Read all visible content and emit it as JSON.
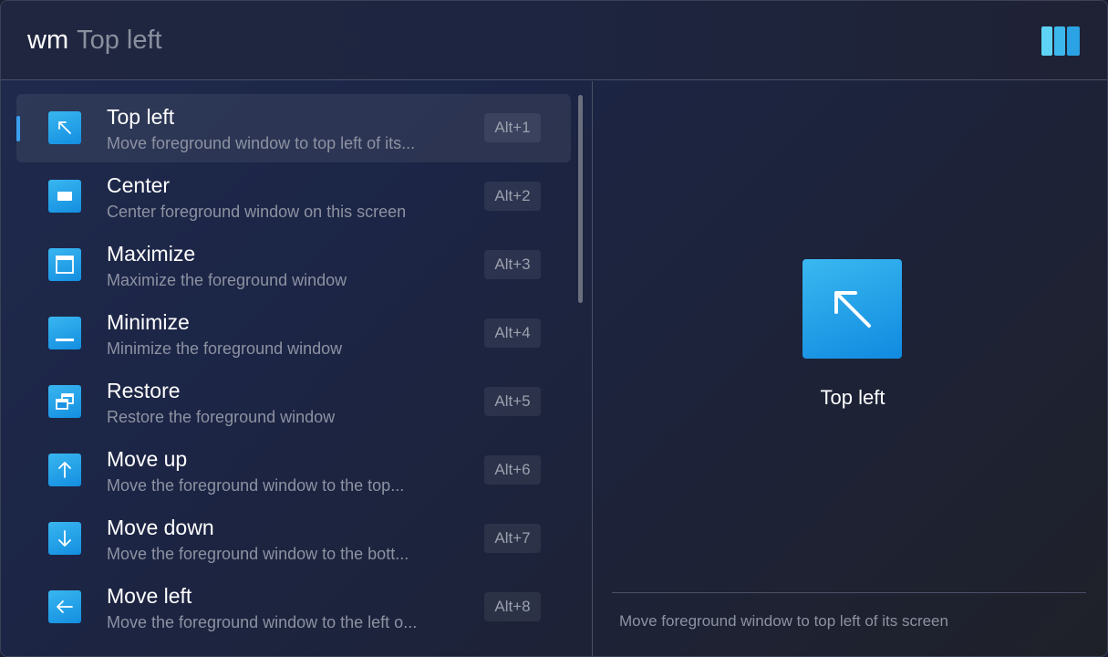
{
  "header": {
    "prefix": "wm",
    "query": "Top left",
    "logo_icon": "wm-app-logo-icon"
  },
  "list": {
    "items": [
      {
        "title": "Top left",
        "description": "Move foreground window to top left of its...",
        "shortcut": "Alt+1",
        "icon": "arrow-up-left-icon",
        "selected": true
      },
      {
        "title": "Center",
        "description": "Center foreground window on this screen",
        "shortcut": "Alt+2",
        "icon": "center-window-icon",
        "selected": false
      },
      {
        "title": "Maximize",
        "description": "Maximize the foreground window",
        "shortcut": "Alt+3",
        "icon": "maximize-icon",
        "selected": false
      },
      {
        "title": "Minimize",
        "description": "Minimize the foreground window",
        "shortcut": "Alt+4",
        "icon": "minimize-icon",
        "selected": false
      },
      {
        "title": "Restore",
        "description": "Restore the foreground window",
        "shortcut": "Alt+5",
        "icon": "restore-icon",
        "selected": false
      },
      {
        "title": "Move up",
        "description": "Move the foreground window to the top...",
        "shortcut": "Alt+6",
        "icon": "arrow-up-icon",
        "selected": false
      },
      {
        "title": "Move down",
        "description": "Move the foreground window to the bott...",
        "shortcut": "Alt+7",
        "icon": "arrow-down-icon",
        "selected": false
      },
      {
        "title": "Move left",
        "description": "Move the foreground window to the left o...",
        "shortcut": "Alt+8",
        "icon": "arrow-left-icon",
        "selected": false
      }
    ]
  },
  "detail": {
    "title": "Top left",
    "description": "Move foreground window to top left of its screen",
    "icon": "arrow-up-left-icon"
  },
  "colors": {
    "accent": "#3aa0f0",
    "icon_tile": "#1f9be6"
  }
}
